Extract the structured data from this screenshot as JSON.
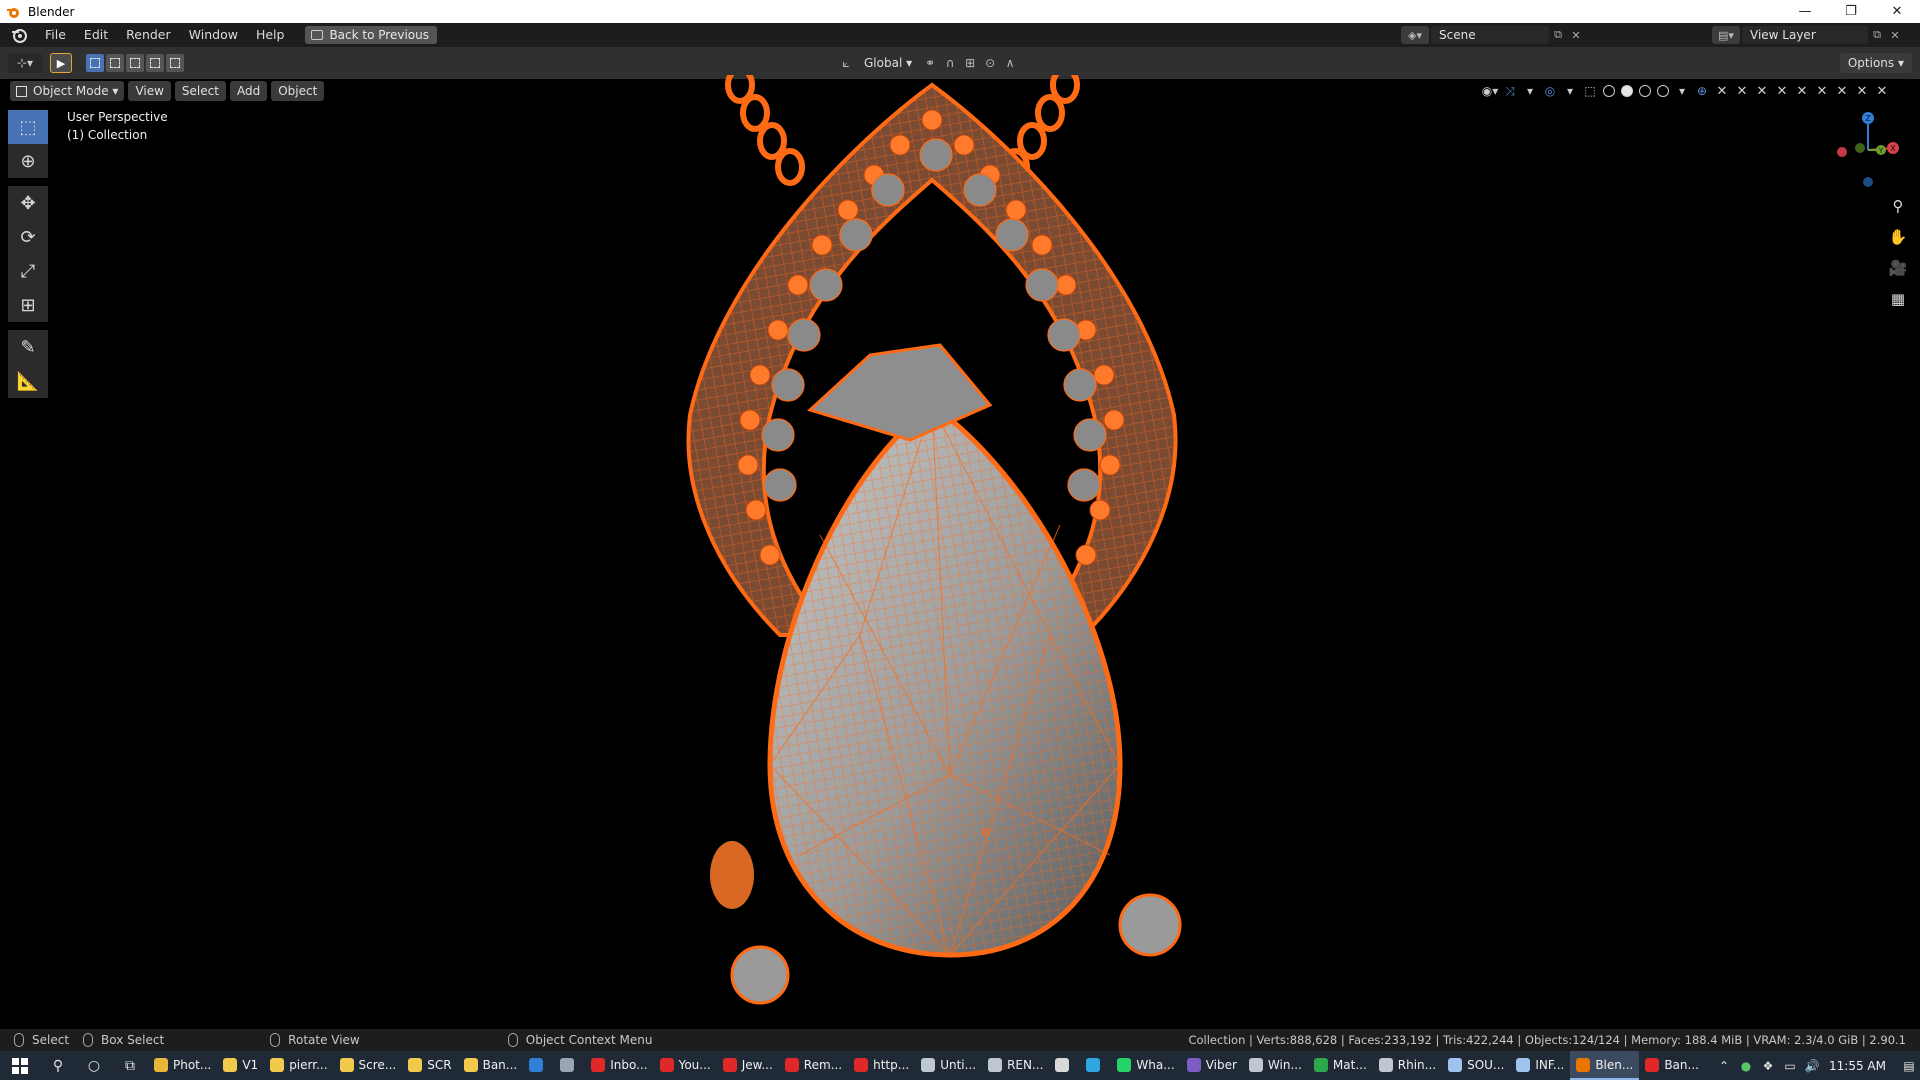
{
  "window": {
    "title": "Blender",
    "minimize": "—",
    "maximize": "❐",
    "close": "✕"
  },
  "menubar": {
    "items": [
      "File",
      "Edit",
      "Render",
      "Window",
      "Help"
    ],
    "back_button": "Back to Previous",
    "scene_name": "Scene",
    "view_layer": "View Layer"
  },
  "header": {
    "orientation": "Global",
    "options": "Options"
  },
  "viewport_header": {
    "mode": "Object Mode",
    "menus": [
      "View",
      "Select",
      "Add",
      "Object"
    ]
  },
  "viewport": {
    "perspective": "User Perspective",
    "collection": "(1) Collection"
  },
  "gizmo": {
    "x_label": "X",
    "y_label": "Y",
    "z_label": "Z"
  },
  "statusbar": {
    "select": "Select",
    "box_select": "Box Select",
    "rotate_view": "Rotate View",
    "context_menu": "Object Context Menu",
    "stats": "Collection | Verts:888,628 | Faces:233,192 | Tris:422,244 | Objects:124/124 | Memory: 188.4 MiB | VRAM: 2.3/4.0 GiB | 2.90.1"
  },
  "taskbar": {
    "tasks": [
      {
        "label": "Phot...",
        "color": "#e8b73a"
      },
      {
        "label": "V1",
        "color": "#f2c94c"
      },
      {
        "label": "pierr...",
        "color": "#f2c94c"
      },
      {
        "label": "Scre...",
        "color": "#f2c94c"
      },
      {
        "label": "SCR",
        "color": "#f2c94c"
      },
      {
        "label": "Ban...",
        "color": "#f2c94c"
      },
      {
        "label": "",
        "color": "#2f7fd8"
      },
      {
        "label": "",
        "color": "#9aa6b2"
      },
      {
        "label": "Inbo...",
        "color": "#e02828"
      },
      {
        "label": "You...",
        "color": "#e02828"
      },
      {
        "label": "Jew...",
        "color": "#e02828"
      },
      {
        "label": "Rem...",
        "color": "#e02828"
      },
      {
        "label": "http...",
        "color": "#e02828"
      },
      {
        "label": "Unti...",
        "color": "#bfc7d0"
      },
      {
        "label": "REN...",
        "color": "#bfc7d0"
      },
      {
        "label": "",
        "color": "#d8d8d8"
      },
      {
        "label": "",
        "color": "#2ea7e0"
      },
      {
        "label": "Wha...",
        "color": "#25d366"
      },
      {
        "label": "Viber",
        "color": "#7d5cc4"
      },
      {
        "label": "Win...",
        "color": "#bfc7d0"
      },
      {
        "label": "Mat...",
        "color": "#2aa84a"
      },
      {
        "label": "Rhin...",
        "color": "#bfc7d0"
      },
      {
        "label": "SOU...",
        "color": "#9ec4ee"
      },
      {
        "label": "INF...",
        "color": "#9ec4ee"
      },
      {
        "label": "Blen...",
        "color": "#ea7600"
      },
      {
        "label": "Ban...",
        "color": "#e02828"
      }
    ],
    "active_task_index": 24,
    "clock": "11:55 AM"
  },
  "colors": {
    "wire_orange": "#ff6a14",
    "accent_blue": "#4772b3",
    "header_bg": "#303030"
  }
}
